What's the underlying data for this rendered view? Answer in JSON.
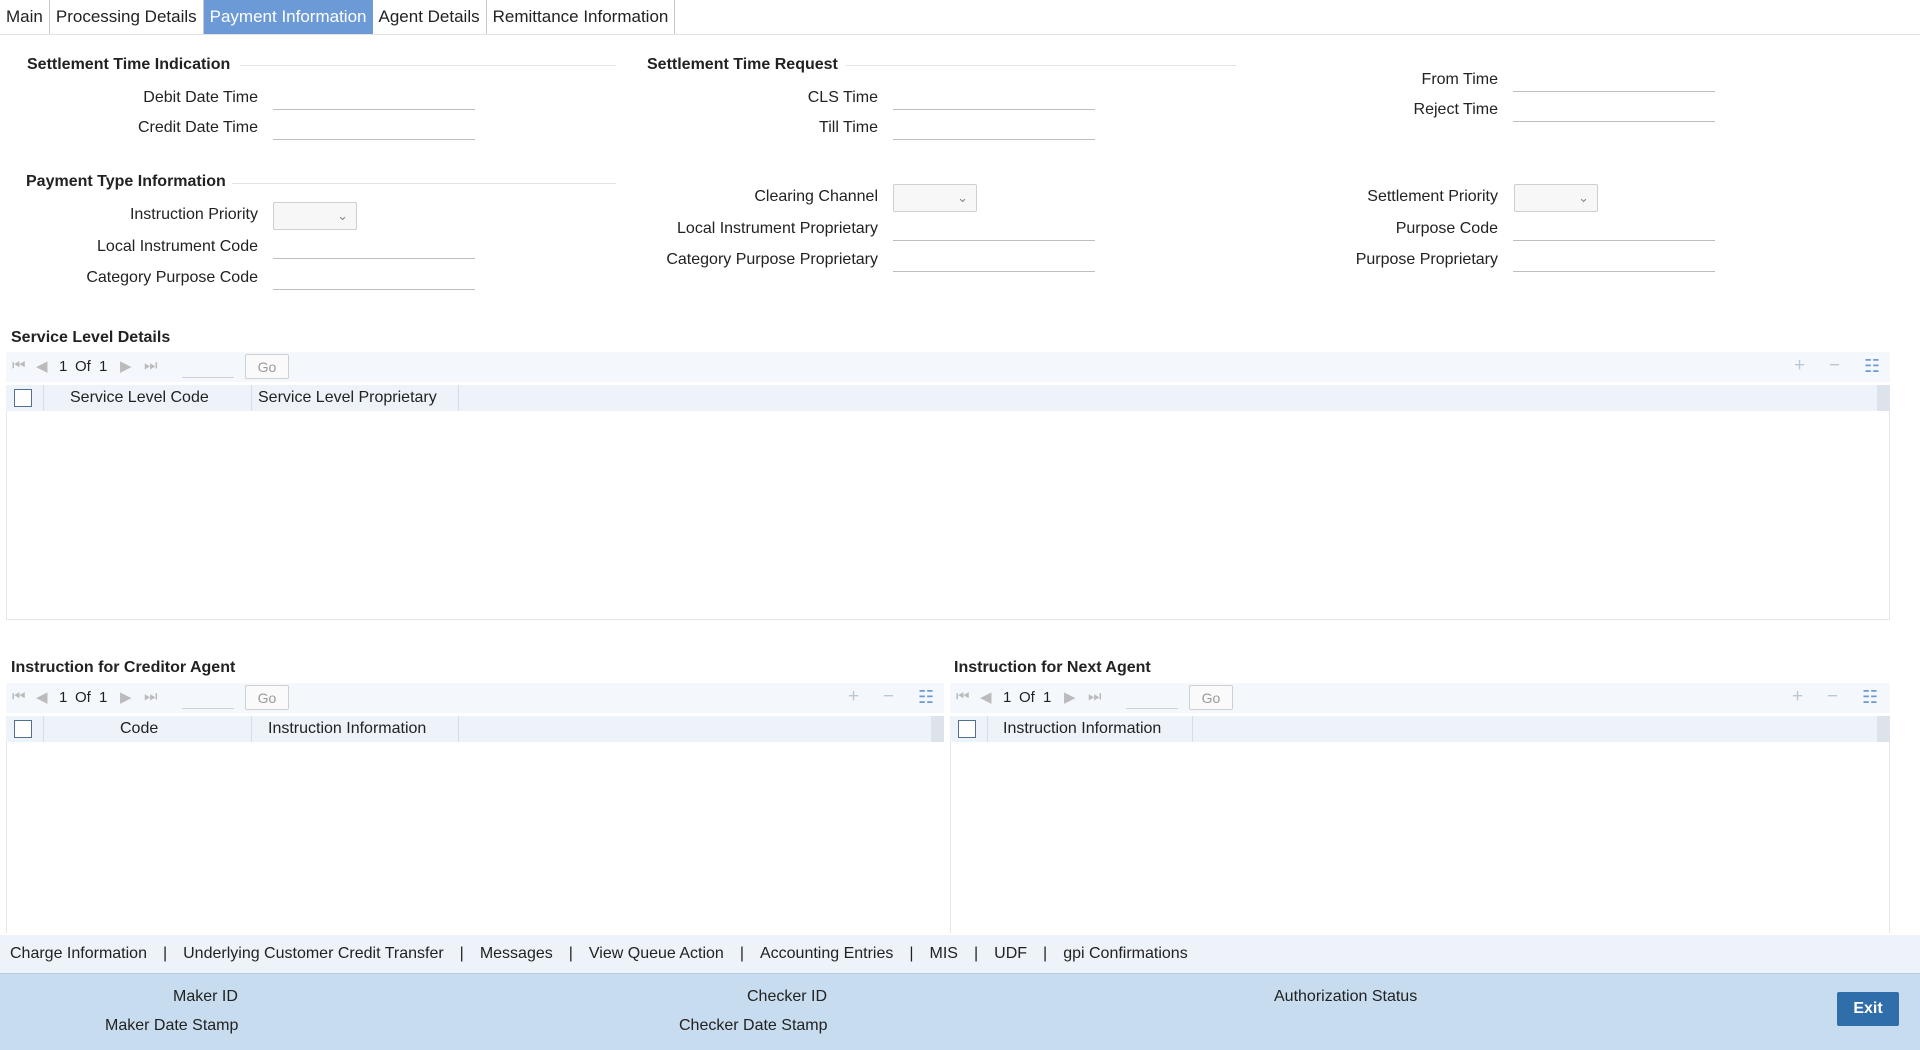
{
  "tabs": [
    "Main",
    "Processing Details",
    "Payment Information",
    "Agent Details",
    "Remittance Information"
  ],
  "settlement_time_indication": {
    "title": "Settlement Time Indication",
    "debit_date_time": "Debit Date Time",
    "credit_date_time": "Credit Date Time"
  },
  "settlement_time_request": {
    "title": "Settlement Time Request",
    "cls_time": "CLS Time",
    "till_time": "Till Time",
    "from_time": "From Time",
    "reject_time": "Reject Time"
  },
  "payment_type_information": {
    "title": "Payment Type Information",
    "instruction_priority": "Instruction Priority",
    "local_instrument_code": "Local Instrument Code",
    "category_purpose_code": "Category Purpose Code",
    "clearing_channel": "Clearing Channel",
    "local_instrument_proprietary": "Local Instrument Proprietary",
    "category_purpose_proprietary": "Category Purpose Proprietary",
    "settlement_priority": "Settlement Priority",
    "purpose_code": "Purpose Code",
    "purpose_proprietary": "Purpose Proprietary"
  },
  "service_level": {
    "title": "Service Level Details",
    "page": "1",
    "of": "Of",
    "total": "1",
    "go": "Go",
    "columns": [
      "Service Level Code",
      "Service Level Proprietary"
    ]
  },
  "creditor_agent": {
    "title": "Instruction for Creditor Agent",
    "page": "1",
    "of": "Of",
    "total": "1",
    "go": "Go",
    "columns": [
      "Code",
      "Instruction Information"
    ]
  },
  "next_agent": {
    "title": "Instruction for Next Agent",
    "page": "1",
    "of": "Of",
    "total": "1",
    "go": "Go",
    "columns": [
      "Instruction Information"
    ]
  },
  "links": [
    "Charge Information",
    "Underlying Customer Credit Transfer",
    "Messages",
    "View Queue Action",
    "Accounting Entries",
    "MIS",
    "UDF",
    "gpi Confirmations"
  ],
  "link_separator": "|",
  "footer": {
    "maker_id": "Maker ID",
    "maker_date_stamp": "Maker Date Stamp",
    "checker_id": "Checker ID",
    "checker_date_stamp": "Checker Date Stamp",
    "authorization_status": "Authorization Status",
    "exit": "Exit"
  },
  "icons": {
    "first": "⏮",
    "prev": "◀",
    "next": "▶",
    "last": "⏭",
    "add": "+",
    "remove": "−",
    "list": "☷",
    "chevron": "⌄"
  },
  "colors": {
    "active_tab": "#6b9ad6",
    "footer_bg": "#c7dcee",
    "exit_button": "#2f6ea8"
  }
}
